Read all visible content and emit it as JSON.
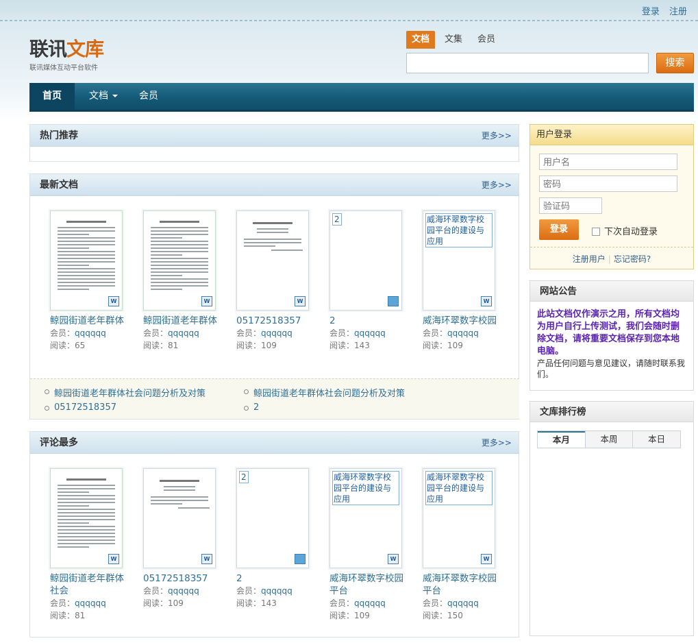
{
  "top_links": [
    "登录",
    "注册"
  ],
  "logo": {
    "main_a": "联讯",
    "main_b": "文库",
    "sub": "联讯媒体互动平台软件"
  },
  "search": {
    "tabs": [
      "文档",
      "文集",
      "会员"
    ],
    "button": "搜索",
    "placeholder": ""
  },
  "nav": {
    "home": "首页",
    "docs": "文档",
    "members": "会员"
  },
  "hot": {
    "title": "热门推荐",
    "more": "更多>>"
  },
  "latest": {
    "title": "最新文档",
    "more": "更多>>",
    "docs": [
      {
        "title": "鲸园街道老年群体",
        "member_label": "会员：",
        "member": "qqqqqq",
        "reads_label": "阅读：",
        "reads": "65",
        "tag": ""
      },
      {
        "title": "鲸园街道老年群体",
        "member_label": "会员：",
        "member": "qqqqqq",
        "reads_label": "阅读：",
        "reads": "81",
        "tag": ""
      },
      {
        "title": "05172518357",
        "member_label": "会员：",
        "member": "qqqqqq",
        "reads_label": "阅读：",
        "reads": "109",
        "tag": ""
      },
      {
        "title": "2",
        "member_label": "会员：",
        "member": "qqqqqq",
        "reads_label": "阅读：",
        "reads": "143",
        "tag": "2"
      },
      {
        "title": "威海环翠数字校园",
        "member_label": "会员：",
        "member": "qqqqqq",
        "reads_label": "阅读：",
        "reads": "109",
        "tag": "威海环翠数字校园平台的建设与应用"
      }
    ],
    "list": [
      "鲸园街道老年群体社会问题分析及对策",
      "鲸园街道老年群体社会问题分析及对策",
      "05172518357",
      "2"
    ]
  },
  "comments": {
    "title": "评论最多",
    "more": "更多>>",
    "docs": [
      {
        "title": "鲸园街道老年群体社会",
        "member_label": "会员：",
        "member": "qqqqqq",
        "reads_label": "阅读：",
        "reads": "81",
        "tag": ""
      },
      {
        "title": "05172518357",
        "member_label": "会员：",
        "member": "qqqqqq",
        "reads_label": "阅读：",
        "reads": "109",
        "tag": ""
      },
      {
        "title": "2",
        "member_label": "会员：",
        "member": "qqqqqq",
        "reads_label": "阅读：",
        "reads": "143",
        "tag": "2"
      },
      {
        "title": "威海环翠数字校园平台",
        "member_label": "会员：",
        "member": "qqqqqq",
        "reads_label": "阅读：",
        "reads": "109",
        "tag": "威海环翠数字校园平台的建设与应用"
      },
      {
        "title": "威海环翠数字校园平台",
        "member_label": "会员：",
        "member": "qqqqqq",
        "reads_label": "阅读：",
        "reads": "150",
        "tag": "威海环翠数字校园平台的建设与应用"
      }
    ]
  },
  "login": {
    "title": "用户登录",
    "username_placeholder": "用户名",
    "password_placeholder": "密码",
    "captcha_placeholder": "验证码",
    "button": "登录",
    "remember": "下次自动登录",
    "register": "注册用户",
    "forgot": "忘记密码?"
  },
  "notice": {
    "title": "网站公告",
    "strong": "此站文档仅作演示之用，所有文档均为用户自行上传测试，我们会随时删除文档，请将重要文档保存到您本地电脑。",
    "small": "产品任何问题与意见建议，请随时联系我们。"
  },
  "ranking": {
    "title": "文库排行榜",
    "tabs": [
      "本月",
      "本周",
      "本日"
    ]
  }
}
